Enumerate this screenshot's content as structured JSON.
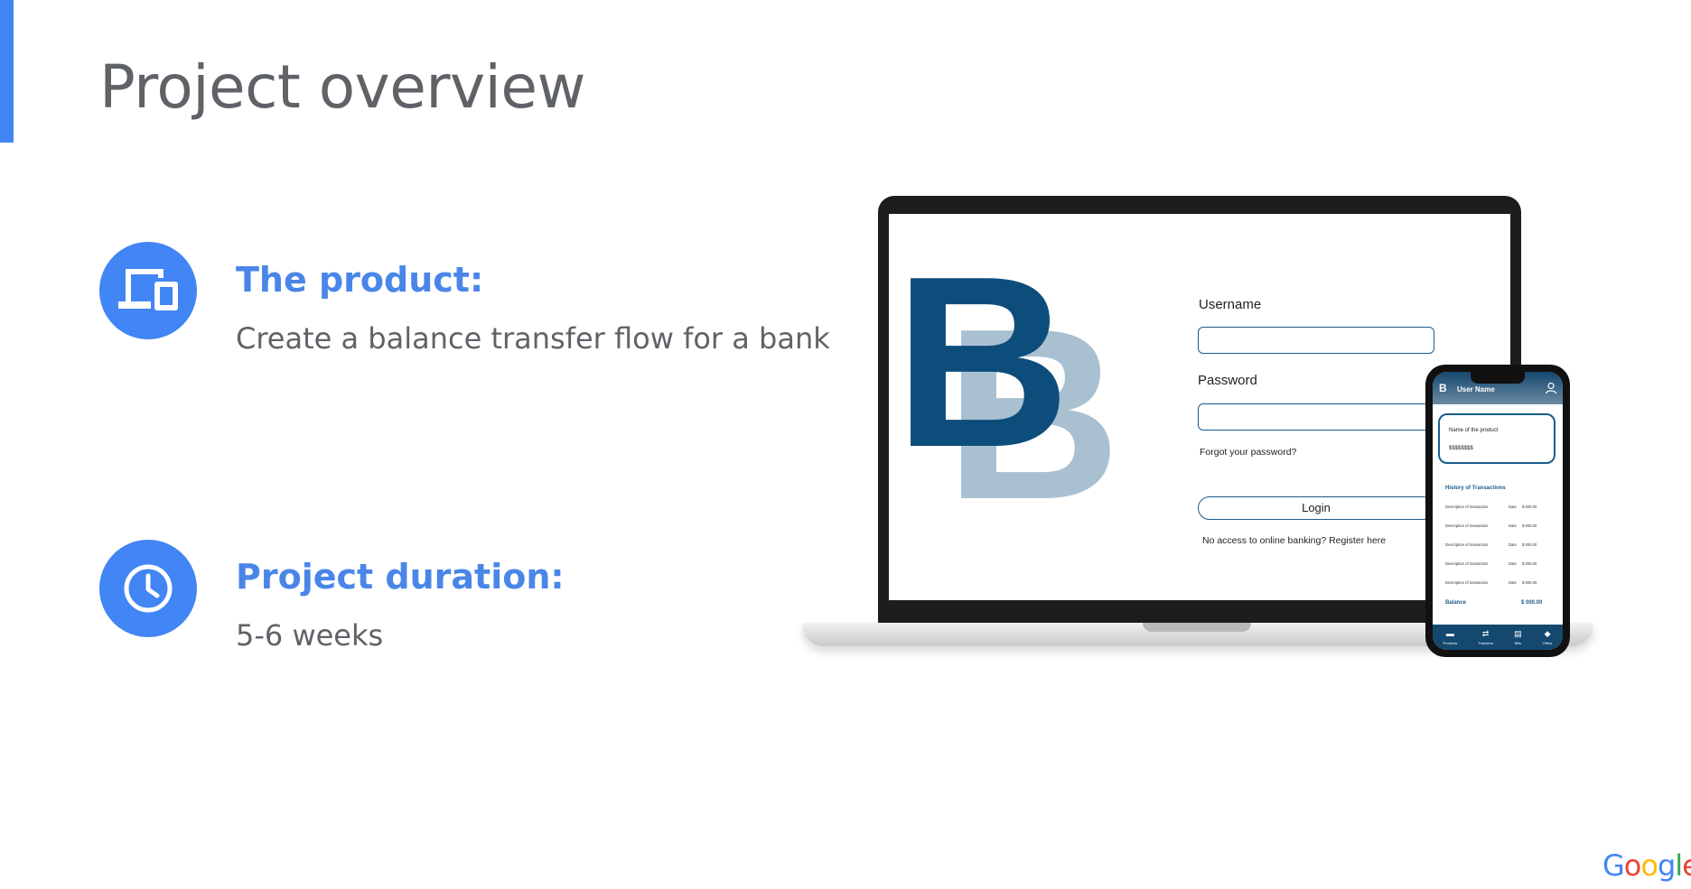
{
  "header": {
    "title": "Project overview"
  },
  "sections": [
    {
      "icon": "devices-icon",
      "heading": "The product:",
      "text": "Create a balance transfer flow for a bank"
    },
    {
      "icon": "clock-icon",
      "heading": "Project duration:",
      "text": "5-6 weeks"
    }
  ],
  "laptop_mockup": {
    "logo_letters": [
      "B",
      "B"
    ],
    "username_label": "Username",
    "password_label": "Password",
    "forgot_password": "Forgot your password?",
    "login_button": "Login",
    "register_text": "No access to online banking? Register here"
  },
  "phone_mockup": {
    "brand": "B",
    "user_name": "User Name",
    "product_name": "Name of the product",
    "product_amount": "$$$$$$$$",
    "history_title": "History of Transactions",
    "transactions": [
      {
        "description": "Description of transaction",
        "date": "Date",
        "amount": "$ 000.00"
      },
      {
        "description": "Description of transaction",
        "date": "Date",
        "amount": "$ 000.00"
      },
      {
        "description": "Description of transaction",
        "date": "Date",
        "amount": "$ 000.00"
      },
      {
        "description": "Description of transaction",
        "date": "Date",
        "amount": "$ 000.00"
      },
      {
        "description": "Description of transaction",
        "date": "Date",
        "amount": "$ 000.00"
      }
    ],
    "balance_label": "Balance",
    "balance_value": "$ 000.00",
    "nav": [
      {
        "icon": "card-icon",
        "label": "Products"
      },
      {
        "icon": "transfer-icon",
        "label": "Transfers"
      },
      {
        "icon": "bill-icon",
        "label": "Bills"
      },
      {
        "icon": "tag-icon",
        "label": "Offers"
      }
    ]
  },
  "footer": {
    "logo_letters": [
      {
        "char": "G",
        "color": "#4285f4"
      },
      {
        "char": "o",
        "color": "#ea4335"
      },
      {
        "char": "o",
        "color": "#fbbc05"
      },
      {
        "char": "g",
        "color": "#4285f4"
      },
      {
        "char": "l",
        "color": "#34a853"
      },
      {
        "char": "e",
        "color": "#ea4335"
      }
    ]
  },
  "colors": {
    "accent": "#4285f4",
    "heading": "#4a86e8",
    "body_text": "#5f6368",
    "bank_navy": "#0d4d7c",
    "bank_light": "#a9c0d1"
  }
}
